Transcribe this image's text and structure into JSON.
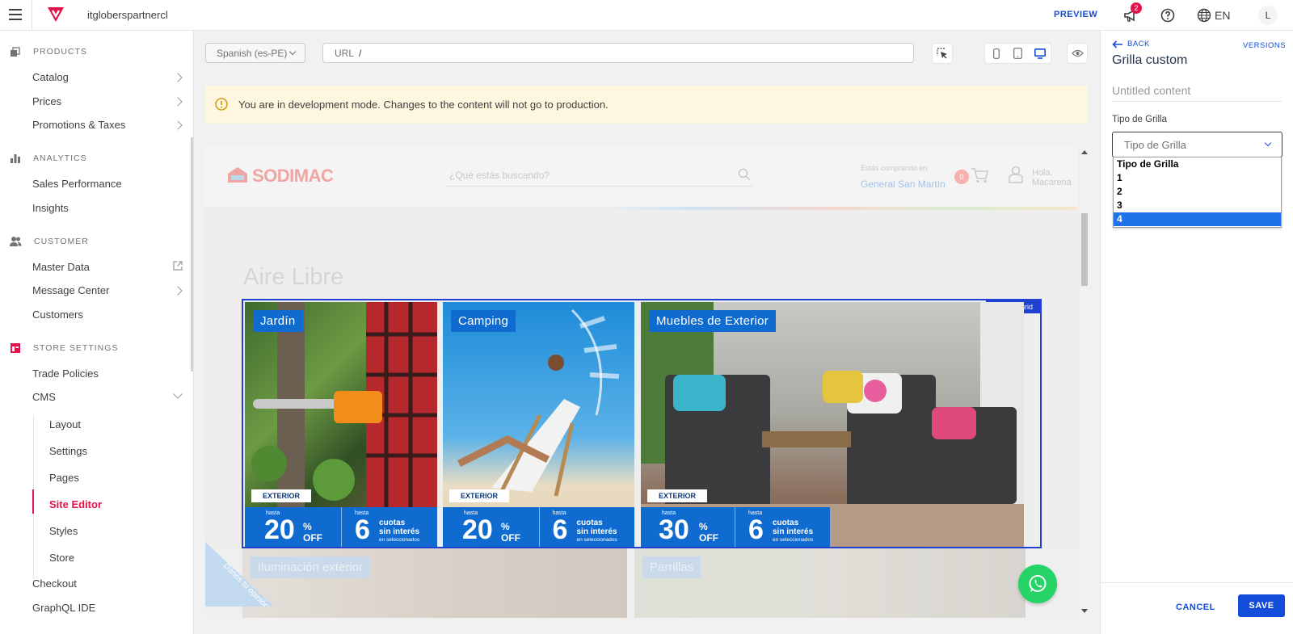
{
  "topbar": {
    "account": "itgloberspartnercl",
    "preview_label": "PREVIEW",
    "notification_count": "2",
    "language": "EN",
    "avatar_initial": "L"
  },
  "sidebar": {
    "sections": [
      {
        "label": "PRODUCTS",
        "items": [
          "Catalog",
          "Prices",
          "Promotions & Taxes"
        ]
      },
      {
        "label": "ANALYTICS",
        "items": [
          "Sales Performance",
          "Insights"
        ]
      },
      {
        "label": "CUSTOMER",
        "items": [
          "Master Data",
          "Message Center",
          "Customers"
        ]
      },
      {
        "label": "STORE SETTINGS",
        "items": [
          "Trade Policies",
          "CMS"
        ]
      }
    ],
    "cms_children": [
      "Layout",
      "Settings",
      "Pages",
      "Site Editor",
      "Styles",
      "Store"
    ],
    "bottom_items": [
      "Checkout",
      "GraphQL IDE"
    ]
  },
  "editor": {
    "locale": "Spanish (es-PE)",
    "url_label": "URL",
    "url_value": "/",
    "warning": "You are in development mode. Changes to the content will not go to production."
  },
  "site_preview": {
    "logo": "SODIMAC",
    "search_placeholder": "¿Qué estás buscando?",
    "shop_label": "Estás comprando en",
    "shop_location": "General San Martín",
    "cart_count": "0",
    "greeting_1": "Hola,",
    "greeting_2": "Macarena",
    "heading": "Aire Libre",
    "grid_tag": "custom grid",
    "cards": [
      {
        "title": "Jardín",
        "label": "EXTERIOR",
        "hasta1": "hasta",
        "pct": "20",
        "pct_sign": "%",
        "off": "OFF",
        "hasta2": "hasta",
        "cuotas": "6",
        "cuotas_line1": "cuotas",
        "cuotas_line2": "sin interés",
        "cuotas_line3": "en seleccionados"
      },
      {
        "title": "Camping",
        "label": "EXTERIOR",
        "hasta1": "hasta",
        "pct": "20",
        "pct_sign": "%",
        "off": "OFF",
        "hasta2": "hasta",
        "cuotas": "6",
        "cuotas_line1": "cuotas",
        "cuotas_line2": "sin interés",
        "cuotas_line3": "en seleccionados"
      },
      {
        "title": "Muebles de Exterior",
        "label": "EXTERIOR",
        "hasta1": "hasta",
        "pct": "30",
        "pct_sign": "%",
        "off": "OFF",
        "hasta2": "hasta",
        "cuotas": "6",
        "cuotas_line1": "cuotas",
        "cuotas_line2": "sin interés",
        "cuotas_line3": "en seleccionados"
      }
    ],
    "lower_cards": [
      "Iluminación exterior",
      "Parrillas"
    ],
    "opinion_text": "Danos tu opinión"
  },
  "right_panel": {
    "back_label": "BACK",
    "versions_label": "VERSIONS",
    "title": "Grilla custom",
    "untitled": "Untitled content",
    "field_label": "Tipo de Grilla",
    "select_value": "Tipo de Grilla",
    "options": [
      "Tipo de Grilla",
      "1",
      "2",
      "3",
      "4"
    ],
    "selected_option": "4",
    "cancel_label": "CANCEL",
    "save_label": "SAVE"
  },
  "colors": {
    "accent": "#134cd8",
    "brand": "#e2134a",
    "grid_outline": "#1f40d0",
    "promo_blue": "#0f6bcf",
    "whatsapp": "#25d366"
  },
  "icons": [
    "menu-icon",
    "vtex-logo",
    "megaphone-icon",
    "help-icon",
    "globe-icon",
    "products-icon",
    "analytics-icon",
    "customer-icon",
    "store-settings-icon",
    "external-link-icon",
    "selector-icon",
    "mobile-icon",
    "tablet-icon",
    "desktop-icon",
    "eye-icon",
    "warning-icon",
    "search-icon",
    "cart-icon",
    "user-icon",
    "whatsapp-icon",
    "back-arrow-icon"
  ]
}
